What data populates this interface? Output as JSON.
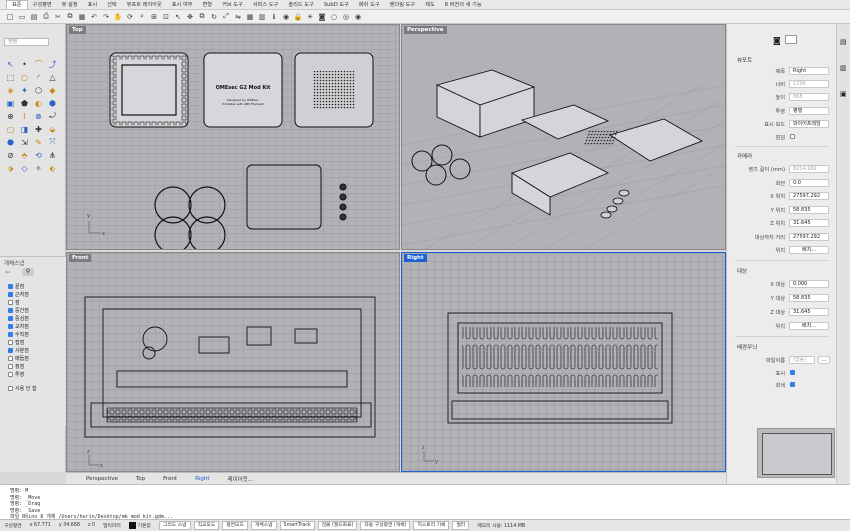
{
  "tabs": [
    "표준",
    "구성평면",
    "뷰 설정",
    "표시",
    "선택",
    "뷰포트 레이아웃",
    "표시 여부",
    "변형",
    "커브 도구",
    "서피스 도구",
    "솔리드 도구",
    "SubD 도구",
    "메쉬 도구",
    "렌더링 도구",
    "제도",
    "8 버전의 새 기능"
  ],
  "active_tab_index": 0,
  "toolbar_icons": [
    "new-file-icon",
    "open-icon",
    "save-icon",
    "print-icon",
    "cut-icon",
    "copy-icon",
    "paste-icon",
    "undo-icon",
    "redo-icon",
    "pan-icon",
    "rotate-view-icon",
    "zoom-icon",
    "zoom-window-icon",
    "zoom-extents-icon",
    "select-icon",
    "move-icon",
    "copy-obj-icon",
    "rotate-icon",
    "scale-icon",
    "mirror-icon",
    "array-icon",
    "layer-icon",
    "properties-icon",
    "render-icon",
    "lock-icon",
    "light-icon",
    "camera-icon",
    "circle-icon",
    "target-icon",
    "eye-icon"
  ],
  "left": {
    "search_placeholder": "명령",
    "layers_title": "개체스냅",
    "layers": [
      {
        "label": "끝점",
        "checked": true
      },
      {
        "label": "근처점",
        "checked": true
      },
      {
        "label": "점",
        "checked": false
      },
      {
        "label": "중간점",
        "checked": true
      },
      {
        "label": "중심점",
        "checked": true
      },
      {
        "label": "교차점",
        "checked": true
      },
      {
        "label": "수직점",
        "checked": true
      },
      {
        "label": "접점",
        "checked": false
      },
      {
        "label": "사분점",
        "checked": true
      },
      {
        "label": "매듭점",
        "checked": false
      },
      {
        "label": "정점",
        "checked": false
      },
      {
        "label": "투영",
        "checked": false
      }
    ],
    "disable_label": "사용 안 함"
  },
  "viewports": {
    "top": "Top",
    "perspective": "Perspective",
    "front": "Front",
    "right": "Right"
  },
  "model_text": {
    "title": "OMEsec G2 Mod Kit",
    "sub1": "Designed by OMEsec",
    "sub2": "Printable with ABS Filament"
  },
  "viewport_tabs": [
    "Perspective",
    "Top",
    "Front",
    "Right",
    "레이아웃..."
  ],
  "active_viewport_tab": "Right",
  "history": [
    "명령: M",
    "명령: _Move",
    "명령: _Drag",
    "명령: _Save",
    "파일 Rhino 8 개체 /Users/hurin/Desktop/mk mod kit.gdm..."
  ],
  "status": {
    "plane": "구성평면",
    "x": "x 67.771",
    "y": "y 34.668",
    "z": "z 0",
    "units": "밀리미터",
    "layer": "기본값",
    "toggles": [
      "그리드 스냅",
      "직교모드",
      "평면모드",
      "개체스냅",
      "SmartTrack",
      "검볼 (월드좌표)",
      "자동 구성평면 (개체)",
      "히스토리 기록",
      "필터"
    ],
    "memory": "메모리 사용: 1114 MB"
  },
  "right_panel": {
    "section_viewport": "뷰포트",
    "title_label": "제목",
    "title_value": "Right",
    "width_label": "너비",
    "width_value": "1296",
    "height_label": "높이",
    "height_value": "868",
    "projection_label": "투영",
    "projection_value": "평행",
    "display_label": "표시 모드",
    "display_value": "와이어프레임",
    "lock_label": "잠김",
    "section_camera": "카메라",
    "lens_label": "렌즈 길이 (mm)",
    "lens_value": "8214.992",
    "rotate_label": "회전",
    "rotate_value": "0.0",
    "xpos_label": "X 위치",
    "xpos_value": "27597.292",
    "ypos_label": "Y 위치",
    "ypos_value": "58.835",
    "zpos_label": "Z 위치",
    "zpos_value": "31.645",
    "dist_label": "대상까지 거리",
    "dist_value": "27597.292",
    "pos_label": "위치",
    "place_btn": "배치...",
    "section_target": "대상",
    "xt_label": "X 대상",
    "xt_value": "0.000",
    "yt_label": "Y 대상",
    "yt_value": "58.835",
    "zt_label": "Z 대상",
    "zt_value": "31.645",
    "tpos_label": "위치",
    "tplace_btn": "배치...",
    "section_bg": "배경무늬",
    "file_label": "파일이름",
    "file_value": "(없음)",
    "show_label": "표시",
    "gray_label": "회색"
  },
  "colors": {
    "accent": "#1f5fd6",
    "viewport": "#b0b2b6",
    "check": "#2f7fe6"
  }
}
